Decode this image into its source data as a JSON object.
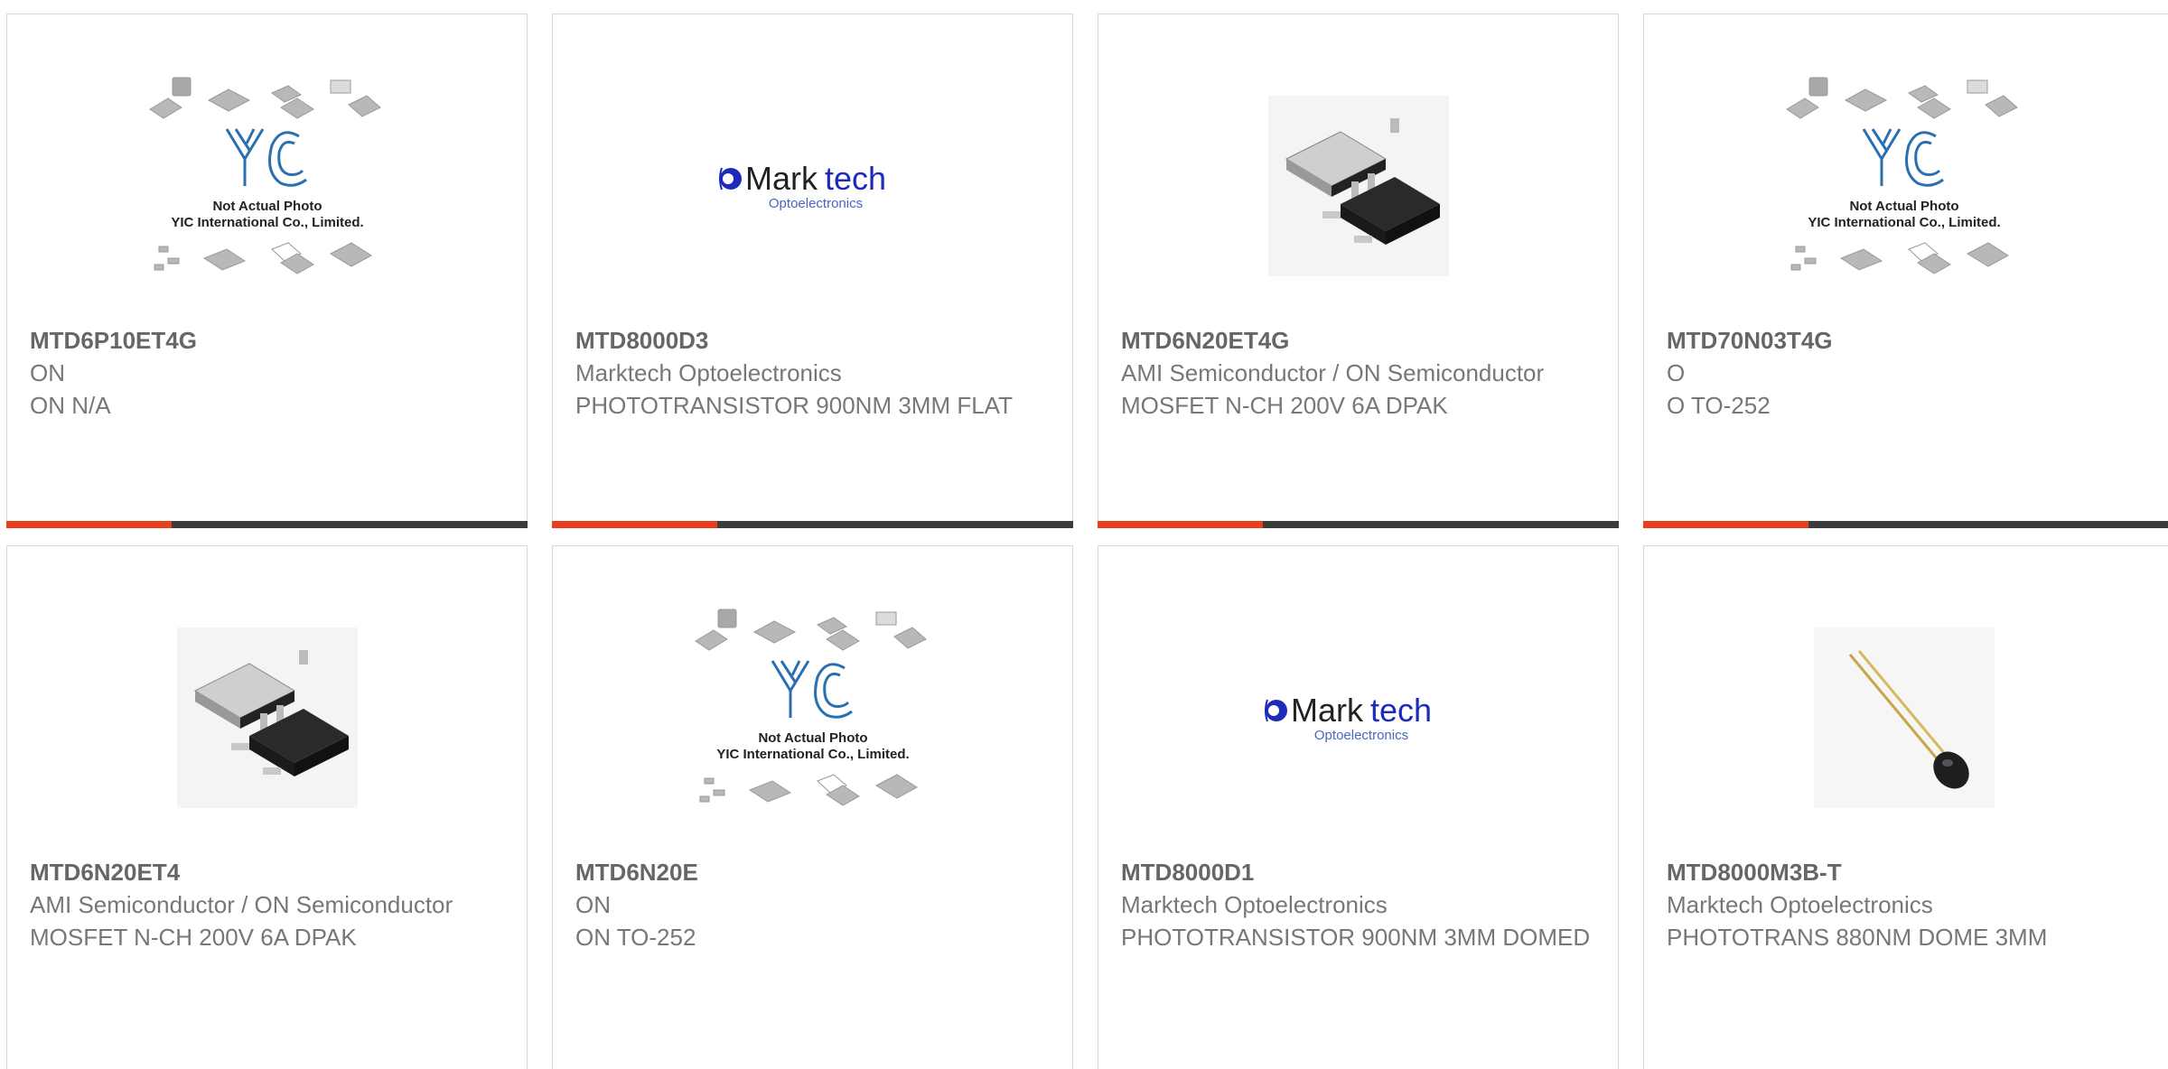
{
  "colors": {
    "accent": "#e8401c",
    "bar_dark": "#3c3c3c",
    "text_title": "#666666",
    "text_body": "#777777"
  },
  "images": {
    "yic": {
      "line1": "Not Actual Photo",
      "line2": "YIC International Co., Limited.",
      "logo": "YIC"
    },
    "marktech": {
      "brand_dark": "Mark",
      "brand_blue": "tech",
      "sub": "Optoelectronics"
    }
  },
  "products": [
    {
      "part_number": "MTD6P10ET4G",
      "manufacturer": "ON",
      "description": "ON N/A",
      "image": "yic-placeholder-icon"
    },
    {
      "part_number": "MTD8000D3",
      "manufacturer": "Marktech Optoelectronics",
      "description": "PHOTOTRANSISTOR 900NM 3MM FLAT",
      "image": "marktech-logo"
    },
    {
      "part_number": "MTD6N20ET4G",
      "manufacturer": "AMI Semiconductor / ON Semiconductor",
      "description": "MOSFET N-CH 200V 6A DPAK",
      "image": "dpak-package-icon"
    },
    {
      "part_number": "MTD70N03T4G",
      "manufacturer": "O",
      "description": "O TO-252",
      "image": "yic-placeholder-icon"
    },
    {
      "part_number": "MTD6N20ET4",
      "manufacturer": "AMI Semiconductor / ON Semiconductor",
      "description": "MOSFET N-CH 200V 6A DPAK",
      "image": "dpak-package-icon"
    },
    {
      "part_number": "MTD6N20E",
      "manufacturer": "ON",
      "description": "ON TO-252",
      "image": "yic-placeholder-icon"
    },
    {
      "part_number": "MTD8000D1",
      "manufacturer": "Marktech Optoelectronics",
      "description": "PHOTOTRANSISTOR 900NM 3MM DOMED",
      "image": "marktech-logo"
    },
    {
      "part_number": "MTD8000M3B-T",
      "manufacturer": "Marktech Optoelectronics",
      "description": "PHOTOTRANS 880NM DOME 3MM",
      "image": "phototransistor-icon"
    }
  ]
}
